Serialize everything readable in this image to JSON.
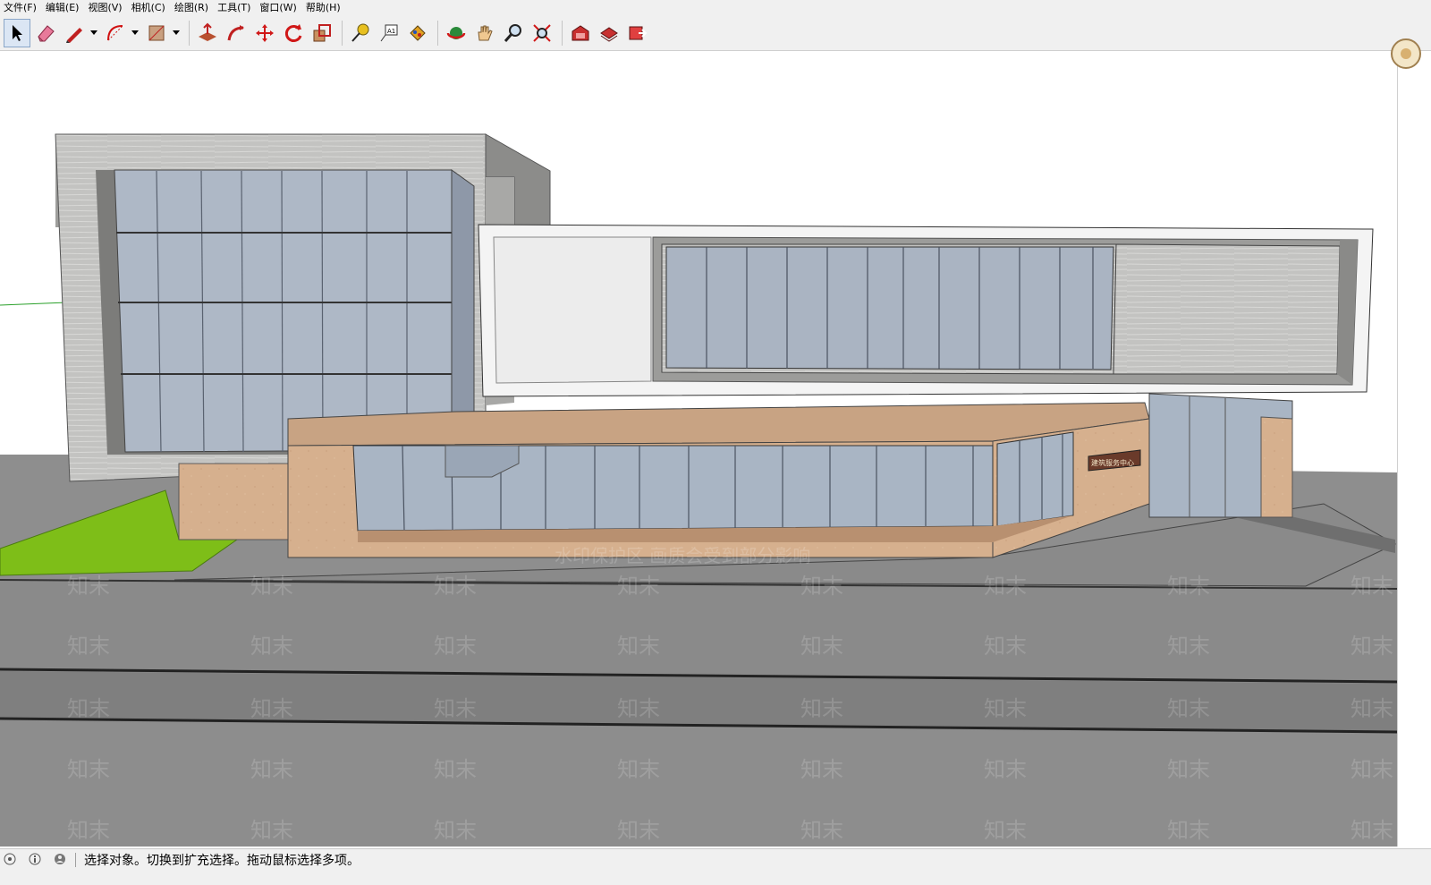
{
  "menu": {
    "items": [
      {
        "label": "文件(F)"
      },
      {
        "label": "编辑(E)"
      },
      {
        "label": "视图(V)"
      },
      {
        "label": "相机(C)"
      },
      {
        "label": "绘图(R)"
      },
      {
        "label": "工具(T)"
      },
      {
        "label": "窗口(W)"
      },
      {
        "label": "帮助(H)"
      }
    ]
  },
  "toolbar": {
    "tools": [
      {
        "icon": "select-arrow-icon",
        "active": true
      },
      {
        "icon": "eraser-icon"
      },
      {
        "icon": "pencil-line-icon"
      },
      {
        "icon": "arc-icon"
      },
      {
        "icon": "rectangle-icon"
      },
      {
        "icon": "push-pull-icon"
      },
      {
        "icon": "follow-me-icon"
      },
      {
        "icon": "move-icon"
      },
      {
        "icon": "rotate-icon"
      },
      {
        "icon": "scale-icon"
      },
      {
        "icon": "tape-measure-icon"
      },
      {
        "icon": "text-icon"
      },
      {
        "icon": "paint-bucket-icon"
      },
      {
        "icon": "orbit-icon"
      },
      {
        "icon": "pan-icon"
      },
      {
        "icon": "zoom-icon"
      },
      {
        "icon": "zoom-extents-icon"
      },
      {
        "icon": "warehouse-icon"
      },
      {
        "icon": "share-model-icon"
      },
      {
        "icon": "extension-icon"
      }
    ]
  },
  "viewport": {
    "watermark_banner": "水印保护区  画质会受到部分影响",
    "watermark_brand": "知末",
    "building_sign": "建筑服务中心"
  },
  "status": {
    "message": "选择对象。切换到扩充选择。拖动鼠标选择多项。"
  },
  "colors": {
    "ui_background": "#f0f0f0",
    "ground_gray": "#8c8c8c",
    "grass_green": "#7fbf1a",
    "facade_beige": "#d9b28f",
    "stone_gray": "#bcbcbc",
    "glass_blue": "#a9b6c6"
  }
}
